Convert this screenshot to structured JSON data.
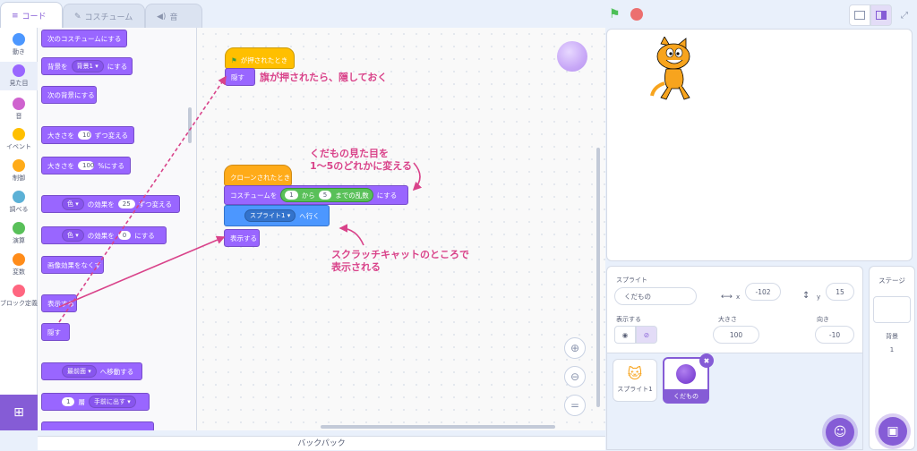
{
  "tabs": {
    "code": "コード",
    "costume": "コスチューム",
    "sound": "音"
  },
  "categories": [
    {
      "label": "動き",
      "color": "#4c97ff"
    },
    {
      "label": "見た目",
      "color": "#9966ff"
    },
    {
      "label": "音",
      "color": "#cf63cf"
    },
    {
      "label": "イベント",
      "color": "#ffbf00"
    },
    {
      "label": "制御",
      "color": "#ffab19"
    },
    {
      "label": "調べる",
      "color": "#5cb1d6"
    },
    {
      "label": "演算",
      "color": "#59c059"
    },
    {
      "label": "変数",
      "color": "#ff8c1a"
    },
    {
      "label": "ブロック定義",
      "color": "#ff6680"
    }
  ],
  "palette": {
    "next_costume": "次のコスチュームにする",
    "backdrop_pre": "背景を",
    "backdrop_dd": "背景1",
    "backdrop_post": "にする",
    "next_backdrop": "次の背景にする",
    "change_size_pre": "大きさを",
    "change_size_val": "10",
    "change_size_post": "ずつ変える",
    "set_size_pre": "大きさを",
    "set_size_val": "100",
    "set_size_post": "%にする",
    "change_effect_dd": "色",
    "change_effect_mid": "の効果を",
    "change_effect_val": "25",
    "change_effect_post": "ずつ変える",
    "set_effect_dd": "色",
    "set_effect_mid": "の効果を",
    "set_effect_val": "0",
    "set_effect_post": "にする",
    "clear_effects": "画像効果をなくす",
    "show": "表示する",
    "hide": "隠す",
    "front_dd": "最前面",
    "front_post": "へ移動する",
    "layer_val": "1",
    "layer_mid": "層",
    "layer_dd": "手前に出す"
  },
  "scripts": {
    "flag_hat": "が押されたとき",
    "hide": "隠す",
    "clone_hat": "クローンされたとき",
    "costume_pre": "コスチュームを",
    "rand_from": "1",
    "rand_mid": "から",
    "rand_to": "5",
    "rand_post": "までの乱数",
    "costume_post": "にする",
    "goto_dd": "スプライト1",
    "goto_post": "へ行く",
    "show": "表示する"
  },
  "annotations": {
    "a1": "旗が押されたら、隠しておく",
    "a2_line1": "くだもの見た目を",
    "a2_line2": "1〜5のどれかに変える",
    "a3_line1": "スクラッチキャットのところで",
    "a3_line2": "表示される"
  },
  "zoom": {
    "reset": "="
  },
  "backpack": "バックパック",
  "sprite_info": {
    "sprite_label": "スプライト",
    "sprite_name": "くだもの",
    "x_label": "x",
    "x_val": "-102",
    "y_label": "y",
    "y_val": "15",
    "show_label": "表示する",
    "size_label": "大きさ",
    "size_val": "100",
    "dir_label": "向き",
    "dir_val": "-10"
  },
  "sprites": [
    {
      "name": "スプライト1"
    },
    {
      "name": "くだもの"
    }
  ],
  "stage_panel": {
    "title": "ステージ",
    "bg_label": "背景",
    "bg_count": "1"
  },
  "colors": {
    "accent": "#855cd6",
    "looks": "#9966ff",
    "annotation": "#d9438a"
  }
}
